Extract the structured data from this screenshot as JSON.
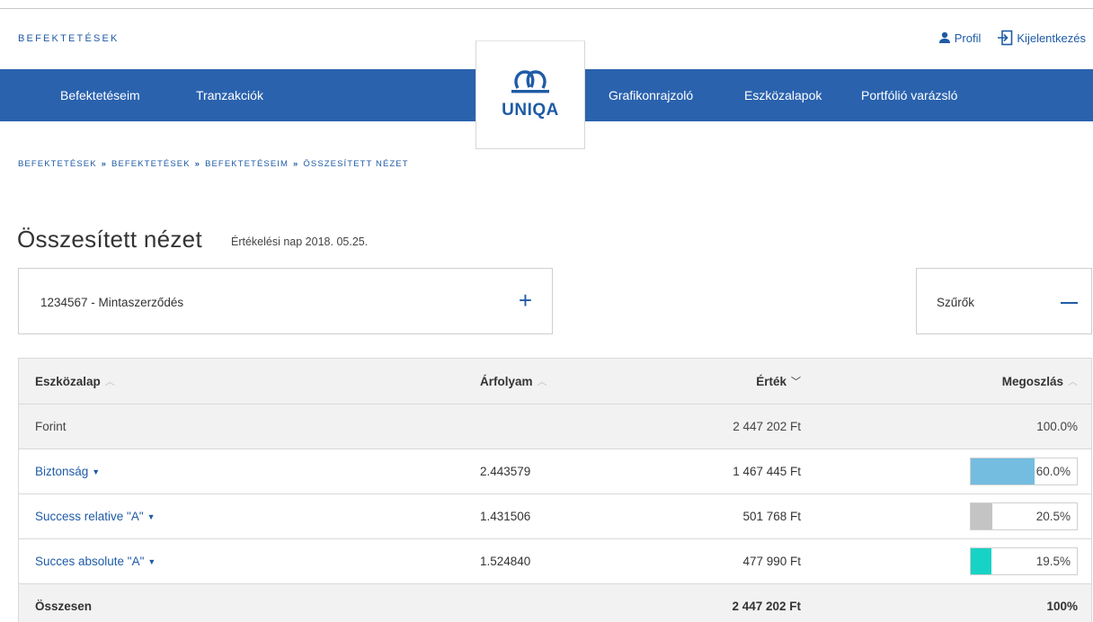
{
  "header": {
    "brand": "BEFEKTETÉSEK",
    "profile_label": "Profil",
    "logout_label": "Kijelentkezés",
    "logo_text": "UNIQA"
  },
  "nav": {
    "items": [
      "Befektetéseim",
      "Tranzakciók",
      "Grafikonrajzoló",
      "Eszközalapok",
      "Portfólió varázsló"
    ]
  },
  "breadcrumb": [
    "BEFEKTETÉSEK",
    "BEFEKTETÉSEK",
    "BEFEKTETÉSEIM",
    "ÖSSZESÍTETT NÉZET"
  ],
  "breadcrumb_sep": "»",
  "page": {
    "title": "Összesített nézet",
    "subtitle": "Értékelési nap 2018. 05.25."
  },
  "contract": {
    "label": "1234567 - Mintaszerződés",
    "toggle": "+"
  },
  "filters": {
    "label": "Szűrők"
  },
  "table": {
    "columns": [
      "Eszközalap",
      "Árfolyam",
      "Érték",
      "Megoszlás"
    ],
    "subtotal": {
      "name": "Forint",
      "value": "2 447 202 Ft",
      "share": "100.0%"
    },
    "rows": [
      {
        "name": "Biztonság",
        "rate": "2.443579",
        "value": "1 467 445 Ft",
        "share": "60.0%",
        "share_fraction": 0.6,
        "color": "#74bde0"
      },
      {
        "name": "Success relative \"A\"",
        "rate": "1.431506",
        "value": "501 768 Ft",
        "share": "20.5%",
        "share_fraction": 0.205,
        "color": "#c4c4c4"
      },
      {
        "name": "Succes absolute \"A\"",
        "rate": "1.524840",
        "value": "477 990 Ft",
        "share": "19.5%",
        "share_fraction": 0.195,
        "color": "#17d3c6"
      }
    ],
    "total": {
      "name": "Összesen",
      "value": "2 447 202 Ft",
      "share": "100%"
    }
  },
  "colors": {
    "primary": "#2a62ae",
    "link": "#1f5ba6"
  }
}
